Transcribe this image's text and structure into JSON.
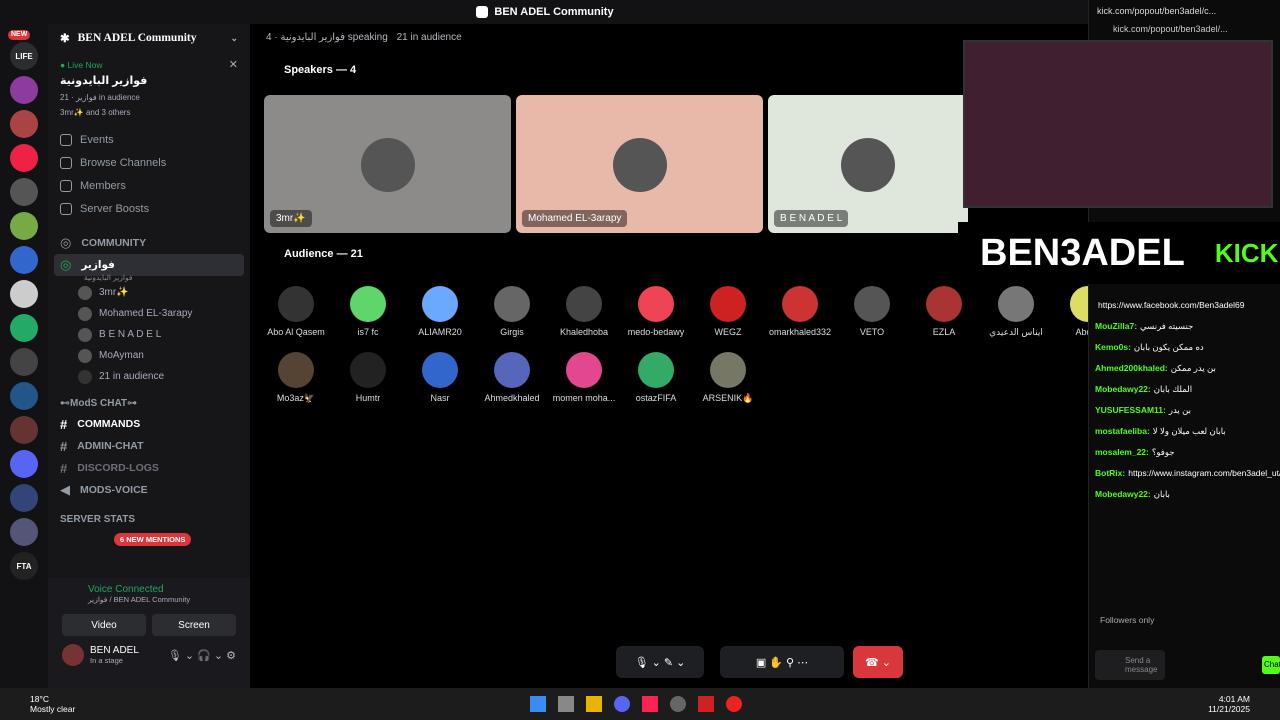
{
  "window_title": "BEN ADEL Community",
  "guild": {
    "name": "BEN ADEL Community"
  },
  "live": {
    "label": "Live Now",
    "title": "فوازير البايدونية",
    "sub_category": "فوازير",
    "audience": "21 in audience",
    "others": "3mr✨ and 3 others"
  },
  "nav": [
    "Events",
    "Browse Channels",
    "Members",
    "Server Boosts"
  ],
  "community": "COMMUNITY",
  "stage": {
    "name": "فوازير",
    "subtitle": "فوازير البايدونية",
    "members": [
      "3mr✨",
      "Mohamed EL-3arapy",
      "B E N A D E L",
      "MoAyman"
    ],
    "in_audience": "21 in audience"
  },
  "mods_cat": "⊷ModS CHAT⊶",
  "mod_channels": [
    "COMMANDS",
    "ADMIN-CHAT",
    "DISCORD-LOGS",
    "MODS-VOICE"
  ],
  "server_stats": "SERVER STATS",
  "mentions": "6 NEW MENTIONS",
  "voice": {
    "status": "Voice Connected",
    "sub": "فوازير / BEN ADEL Community",
    "video": "Video",
    "screen": "Screen"
  },
  "user": {
    "name": "BEN ADEL",
    "status": "In a stage"
  },
  "header": {
    "title": "فوازير البايدونية",
    "speaking": "4 speaking",
    "audience": "21 in audience"
  },
  "speakers_title": "Speakers — 4",
  "speakers": [
    {
      "name": "3mr✨",
      "bg": "#8c8b89"
    },
    {
      "name": "Mohamed EL-3arapy",
      "bg": "#e8b8a8"
    },
    {
      "name": "B E N A D E L",
      "bg": "#dfe6dc"
    },
    {
      "name": "MoAyman",
      "bg": "#888"
    }
  ],
  "audience_title": "Audience — 21",
  "audience": [
    {
      "name": "Abo Al Qasem",
      "c": "#333"
    },
    {
      "name": "is7 fc",
      "c": "#5fd66a"
    },
    {
      "name": "ALIAMR20",
      "c": "#6aa9ff"
    },
    {
      "name": "Girgis",
      "c": "#666"
    },
    {
      "name": "Khaledhoba",
      "c": "#444"
    },
    {
      "name": "medo-bedawy",
      "c": "#ee4455"
    },
    {
      "name": "WEGZ",
      "c": "#c22"
    },
    {
      "name": "omarkhaled332",
      "c": "#c33"
    },
    {
      "name": "VETO",
      "c": "#555"
    },
    {
      "name": "EZLA",
      "c": "#a33"
    },
    {
      "name": "ايناس الدعيدي",
      "c": "#777"
    },
    {
      "name": "Abdall",
      "c": "#dd6"
    },
    {
      "name": "Mo3az🦅",
      "c": "#543"
    },
    {
      "name": "Humtr",
      "c": "#222"
    },
    {
      "name": "Nasr",
      "c": "#36c"
    },
    {
      "name": "Ahmedkhaled",
      "c": "#56b"
    },
    {
      "name": "momen moha...",
      "c": "#e3478f"
    },
    {
      "name": "ostazFIFA",
      "c": "#3a6"
    },
    {
      "name": "ARSENIK🔥",
      "c": "#776"
    }
  ],
  "kick": {
    "url_title": "kick.com/popout/ben3adel/c...",
    "url": "kick.com/popout/ben3adel/...",
    "brand": "BEN3ADEL",
    "kick": "KICK",
    "followers": "Followers only",
    "send": "Send a message",
    "chat": "Chat"
  },
  "chat": [
    {
      "u": "",
      "t": "https://www.facebook.com/Ben3adel69"
    },
    {
      "u": "MouZilla7:",
      "t": "جنسيته فرنسي"
    },
    {
      "u": "Kemo0s:",
      "t": "ده ممكن يكون بابان"
    },
    {
      "u": "Ahmed200khaled:",
      "t": "بن يدر ممكن"
    },
    {
      "u": "Mobedawy22:",
      "t": "الملك بابان"
    },
    {
      "u": "YUSUFESSAM11:",
      "t": "بن يدر"
    },
    {
      "u": "mostafaeliba:",
      "t": "بابان لعب ميلان ولا لا"
    },
    {
      "u": "mosalem_22:",
      "t": "جوفو؟"
    },
    {
      "u": "BotRix:",
      "t": "https://www.instagram.com/ben3adel_ut/"
    },
    {
      "u": "Mobedawy22:",
      "t": "بابان"
    }
  ],
  "taskbar": {
    "temp": "18°C",
    "weather": "Mostly clear",
    "time": "4:01 AM",
    "date": "11/21/2025"
  }
}
